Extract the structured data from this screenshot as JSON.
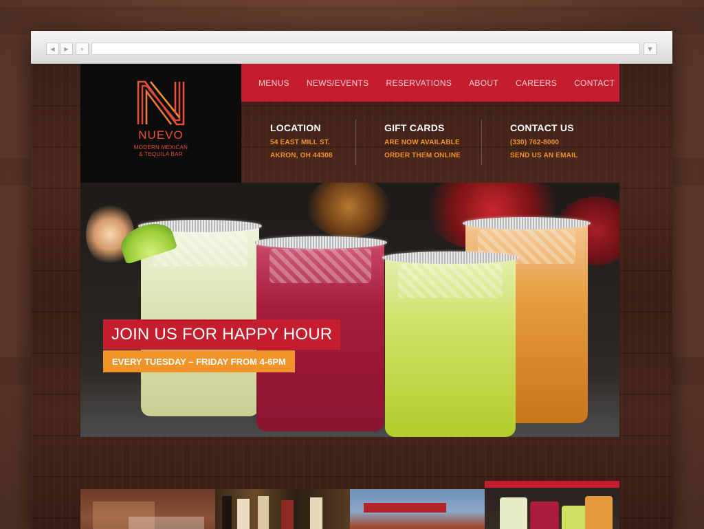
{
  "browser": {
    "back_glyph": "◀",
    "forward_glyph": "▶",
    "new_tab_glyph": "+",
    "menu_glyph": "▼"
  },
  "brand": {
    "name": "NUEVO",
    "tagline_1": "MODERN MEXICAN",
    "tagline_2": "& TEQUILA BAR",
    "logo_icon": "stylized-n-icon",
    "colors": {
      "red": "#c41e2e",
      "orange": "#f0942a",
      "logo": "#e8513a"
    }
  },
  "nav": {
    "items": [
      {
        "label": "MENUS"
      },
      {
        "label": "NEWS/EVENTS"
      },
      {
        "label": "RESERVATIONS"
      },
      {
        "label": "ABOUT"
      },
      {
        "label": "CAREERS"
      },
      {
        "label": "CONTACT"
      }
    ]
  },
  "info": {
    "location": {
      "title": "LOCATION",
      "line1": "54 EAST MILL ST.",
      "line2": "AKRON, OH 44308"
    },
    "gift_cards": {
      "title": "GIFT CARDS",
      "line1": "ARE NOW AVAILABLE",
      "line2": "ORDER THEM ONLINE"
    },
    "contact": {
      "title": "CONTACT US",
      "line1": "(330) 762-8000",
      "line2": "SEND US AN EMAIL"
    }
  },
  "hero": {
    "title": "JOIN US FOR HAPPY HOUR",
    "subtitle": "EVERY TUESDAY – FRIDAY FROM 4-6PM"
  }
}
